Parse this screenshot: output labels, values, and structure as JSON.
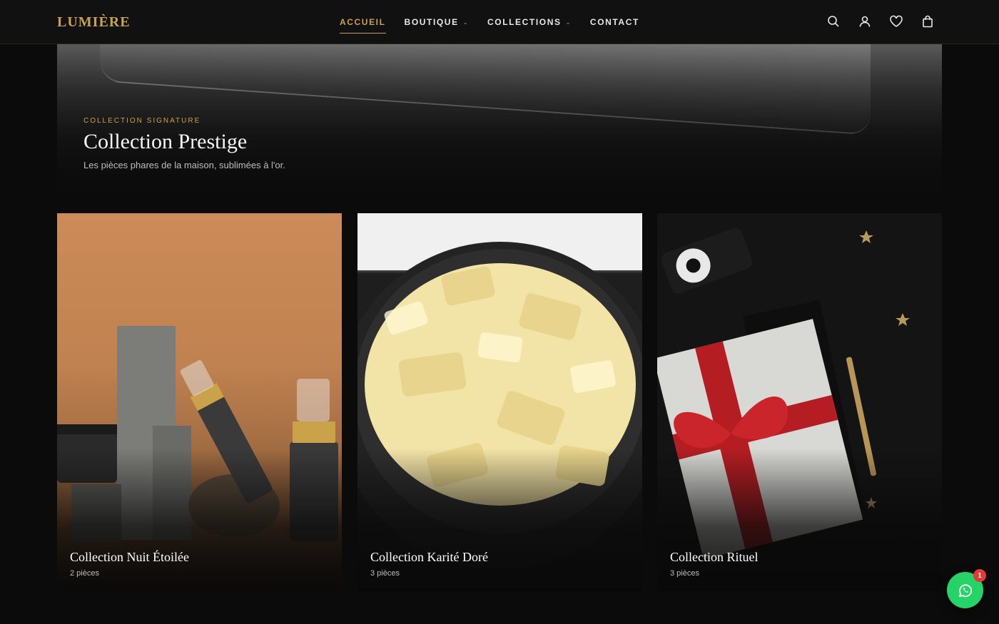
{
  "header": {
    "logo": "LUMIÈRE",
    "nav": [
      {
        "label": "ACCUEIL",
        "active": true,
        "dropdown": false
      },
      {
        "label": "BOUTIQUE",
        "active": false,
        "dropdown": true
      },
      {
        "label": "COLLECTIONS",
        "active": false,
        "dropdown": true
      },
      {
        "label": "CONTACT",
        "active": false,
        "dropdown": false
      }
    ],
    "icons": [
      "search-icon",
      "user-icon",
      "heart-icon",
      "shopping-bag-icon"
    ]
  },
  "hero": {
    "eyebrow": "COLLECTION SIGNATURE",
    "title": "Collection Prestige",
    "subtitle": "Les pièces phares de la maison, sublimées à l'or."
  },
  "collections": [
    {
      "title": "Collection Nuit Étoilée",
      "count": "2 pièces"
    },
    {
      "title": "Collection Karité Doré",
      "count": "3 pièces"
    },
    {
      "title": "Collection Rituel",
      "count": "3 pièces"
    }
  ],
  "whatsapp": {
    "badge": "1"
  },
  "colors": {
    "accent": "#c9a24a",
    "background": "#0b0b0b",
    "whatsapp": "#25d366",
    "badge": "#e53935"
  }
}
